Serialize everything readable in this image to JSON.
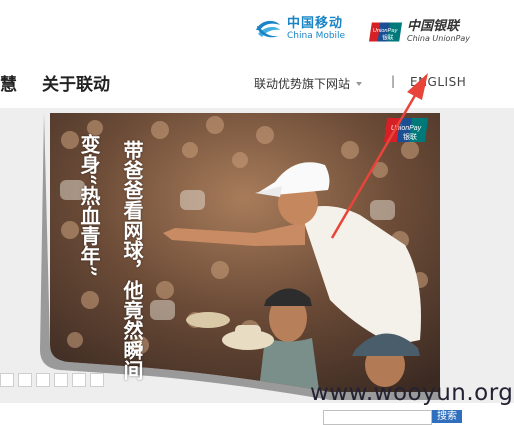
{
  "header": {
    "cmcc_logo": {
      "cn": "中国移动",
      "en": "China Mobile"
    },
    "unionpay_logo": {
      "badge": "UnionPay",
      "badge_cn": "银联",
      "cn": "中国银联",
      "en": "China UnionPay"
    },
    "nav": {
      "partial_item": "慧",
      "about": "关于联动",
      "brand_sites": "联动优势旗下网站",
      "separator": "|",
      "english": "ENGLISH"
    }
  },
  "banner": {
    "slogan_col1": "变身“热血青年”",
    "slogan_col2": "带爸爸看网球，他竟然瞬间",
    "badge": "UnionPay",
    "badge_cn": "银联"
  },
  "footer": {
    "search_placeholder": "",
    "search_button": "搜索"
  },
  "watermark": "www.wooyun.org",
  "colors": {
    "cmcc_blue": "#1a84c6",
    "unionpay_red": "#d71f26",
    "unionpay_teal": "#00797b",
    "unionpay_blue": "#1b4f93",
    "arrow_red": "#e8443a"
  }
}
